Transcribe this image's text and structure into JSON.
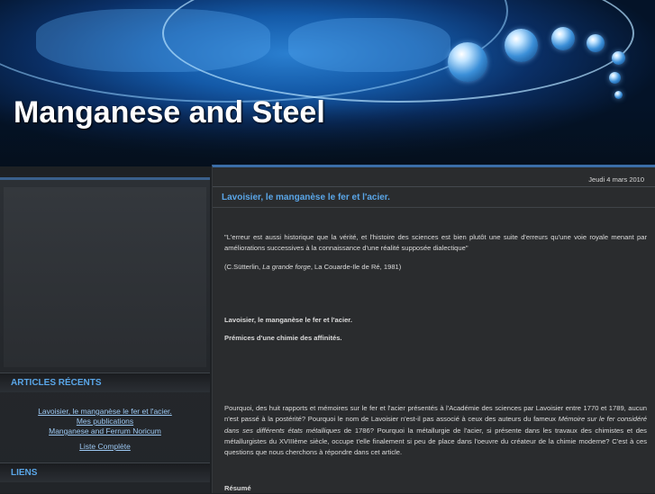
{
  "site": {
    "title": "Manganese and Steel"
  },
  "sidebar": {
    "recent_heading": "ARTICLES RÉCENTS",
    "recent_items": [
      "Lavoisier, le manganèse le fer et l'acier.",
      "Mes publications",
      "Manganese and Ferrum Noricum"
    ],
    "full_list_label": "Liste Complète",
    "links_heading": "LIENS"
  },
  "post": {
    "date": "Jeudi 4 mars 2010",
    "title": "Lavoisier, le manganèse le fer et l'acier.",
    "quote": "\"L'erreur est aussi historique que la vérité, et l'histoire des sciences est bien plutôt une suite d'erreurs qu'une voie royale menant par améliorations successives à la connaissance d'une réalité supposée dialectique\"",
    "citation_author": "(C.Sütterlin, ",
    "citation_book": "La grande forge",
    "citation_rest": ", La Couarde-Ile de Ré, 1981)",
    "subtitle": "Lavoisier, le manganèse  le fer et l'acier.",
    "subtitle2": "Prémices d'une chimie des affinités.",
    "para_part1": "Pourquoi, des huit rapports et  mémoires sur le fer et l'acier présentés à l'Académie des sciences par Lavoisier entre 1770 et 1789, aucun n'est passé à la postérité? Pourquoi le nom de Lavoisier n'est-il pas associé à  ceux des auteurs du fameux ",
    "para_italic": "Mémoire sur le fer considéré dans ses différents états métalliques",
    "para_part2": " de 1786? Pourquoi la métallurgie de l'acier, si présente dans les travaux des chimistes et des métallurgistes du XVIIIème siècle, occupe t'elle finalement si peu de place dans l'oeuvre du créateur de la chimie moderne? C'est à ces questions que nous cherchons à répondre dans cet article.",
    "resume_label": "Résumé"
  },
  "colors": {
    "accent": "#5aa6e8",
    "link": "#9cc8f2",
    "background": "#1e2124"
  }
}
